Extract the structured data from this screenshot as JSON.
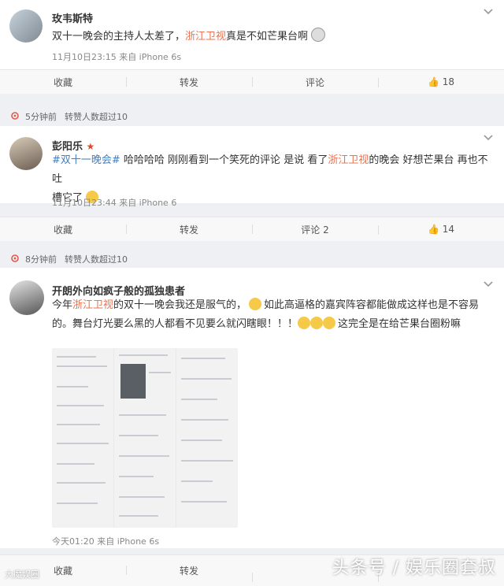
{
  "posts": [
    {
      "username": "玫韦斯特",
      "text_a": "双十一晚会的主持人太差了，",
      "text_red": "浙江卫视",
      "text_b": "真是不如芒果台啊",
      "meta": "11月10日23:15 来自 iPhone 6s",
      "actions": {
        "collect": "收藏",
        "repost": "转发",
        "comment": "评论",
        "like": "18"
      }
    },
    {
      "strip_time": "5分钟前",
      "strip_label": "转赞人数超过10",
      "username": "彭阳乐",
      "hashtag": "#双十一晚会#",
      "text_a": " 哈哈哈哈 刚刚看到一个笑死的评论 是说 看了",
      "text_red": "浙江卫视",
      "text_b": "的晚会 好想芒果台 再也不吐",
      "text_c": "槽它了",
      "meta": "11月10日23:44 来自 iPhone 6",
      "actions": {
        "collect": "收藏",
        "repost": "转发",
        "comment": "评论 2",
        "like": "14"
      }
    },
    {
      "strip_time": "8分钟前",
      "strip_label": "转赞人数超过10",
      "username": "开朗外向如疯子般的孤独患者",
      "text_a": "今年",
      "text_red": "浙江卫视",
      "text_b": "的双十一晚会我还是服气的，",
      "text_c": "如此高逼格的嘉宾阵容都能做成这样也是不容易",
      "text_d": "的。舞台灯光要么黑的人都看不见要么就闪瞎眼！！！",
      "text_e": "这完全是在给芒果台圈粉嘛",
      "meta": "今天01:20 来自 iPhone 6s",
      "actions": {
        "collect": "收藏",
        "repost": "转发"
      }
    }
  ],
  "watermark": "头条号 / 娱乐圈套叔",
  "watermark_small": "大魔娱圈",
  "colors": {
    "accent": "#eb7350",
    "link": "#3f7fc2",
    "emoji": "#f7c948"
  }
}
